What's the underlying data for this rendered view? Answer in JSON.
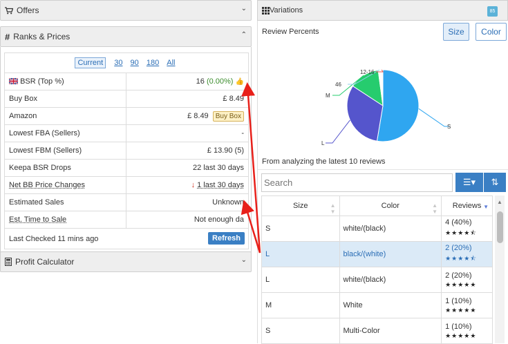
{
  "offers": {
    "title": "Offers"
  },
  "ranks": {
    "title": "Ranks & Prices",
    "periods": {
      "current": "Current",
      "p30": "30",
      "p90": "90",
      "p180": "180",
      "all": "All"
    },
    "rows": [
      {
        "label": "BSR (Top %)",
        "value": "16",
        "value_extra": "(0.00%)"
      },
      {
        "label": "Buy Box",
        "value": "£ 8.49"
      },
      {
        "label": "Amazon",
        "value": "£ 8.49",
        "badge": "Buy Box"
      },
      {
        "label": "Lowest FBA (Sellers)",
        "value": "-"
      },
      {
        "label": "Lowest FBM (Sellers)",
        "value": "£ 13.90 (5)"
      },
      {
        "label": "Keepa BSR Drops",
        "value": "22 last 30 days"
      },
      {
        "label": "Net BB Price Changes",
        "value": "1 last 30 days"
      },
      {
        "label": "Estimated Sales",
        "value": "Unknown"
      },
      {
        "label": "Est. Time to Sale",
        "value": "Not enough da"
      }
    ],
    "last_checked": "Last Checked 11 mins ago",
    "refresh_label": "Refresh"
  },
  "profit": {
    "title": "Profit Calculator"
  },
  "variations": {
    "title": "Variations",
    "badge": "85",
    "review_title": "Review Percents",
    "toggle_size": "Size",
    "toggle_color": "Color",
    "analyzed_note": "From analyzing the latest 10 reviews",
    "search_placeholder": "Search",
    "columns": {
      "size": "Size",
      "color": "Color",
      "reviews": "Reviews"
    },
    "rows": [
      {
        "size": "S",
        "color": "white/(black)",
        "reviews": "4 (40%)",
        "stars": "★★★★⯪"
      },
      {
        "size": "L",
        "color": "black/(white)",
        "reviews": "2 (20%)",
        "stars": "★★★★⯪"
      },
      {
        "size": "L",
        "color": "white/(black)",
        "reviews": "2 (20%)",
        "stars": "★★★★★"
      },
      {
        "size": "M",
        "color": "White",
        "reviews": "1 (10%)",
        "stars": "★★★★★"
      },
      {
        "size": "S",
        "color": "Multi-Color",
        "reviews": "1 (10%)",
        "stars": "★★★★★"
      }
    ]
  },
  "chart_data": {
    "type": "pie",
    "categories": [
      "S",
      "L",
      "M",
      "46",
      "12-16"
    ],
    "values": [
      50,
      30,
      13,
      1,
      1
    ],
    "colors": [
      "#2fa6f0",
      "#5555cc",
      "#26cc6e",
      "#ffffff",
      "#ffffff"
    ],
    "title": ""
  }
}
